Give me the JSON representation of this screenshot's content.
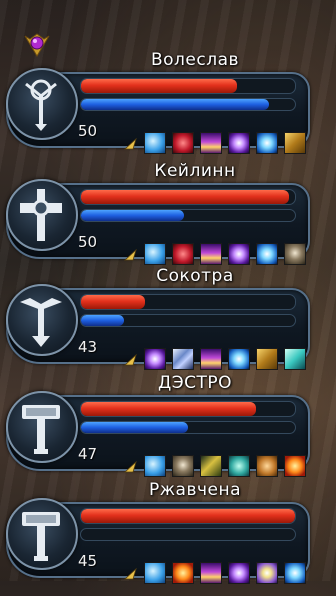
{
  "party": [
    {
      "name": "Волеслав",
      "level": "50",
      "hp": 0.73,
      "mp": 0.88,
      "icon": "scepter-icon",
      "buffs": [
        "spirit-wolf",
        "blood-claw",
        "holy-flame",
        "violet-burst",
        "ice-lightning",
        "gold-scroll"
      ]
    },
    {
      "name": "Кейлинн",
      "level": "50",
      "hp": 0.97,
      "mp": 0.48,
      "icon": "cross-hammer-icon",
      "buffs": [
        "spirit-wolf",
        "blood-claw",
        "holy-flame",
        "violet-burst",
        "ice-lightning",
        "skull-totem"
      ]
    },
    {
      "name": "Сокотра",
      "level": "43",
      "hp": 0.3,
      "mp": 0.2,
      "icon": "winged-scepter-icon",
      "buffs": [
        "violet-burst",
        "blade-storm",
        "holy-flame",
        "ice-lightning",
        "gold-scroll",
        "wind-dash"
      ]
    },
    {
      "name": "ДЭСТРО",
      "level": "47",
      "hp": 0.82,
      "mp": 0.5,
      "icon": "war-hammer-icon",
      "buffs": [
        "spirit-wolf",
        "skull-totem",
        "gold-arrow",
        "crab-spirit",
        "bread-food",
        "fire-burst"
      ]
    },
    {
      "name": "Ржавчена",
      "level": "45",
      "hp": 1.0,
      "mp": 0.0,
      "icon": "war-hammer-icon",
      "buffs": [
        "spirit-wolf",
        "fire-burst",
        "holy-flame",
        "violet-burst",
        "star-spark",
        "ice-lightning"
      ]
    }
  ],
  "leader_icon": "party-leader-crown-icon",
  "colors": {
    "hp": "#e3311c",
    "mp": "#1e5fe0",
    "frame": "#56708a"
  }
}
